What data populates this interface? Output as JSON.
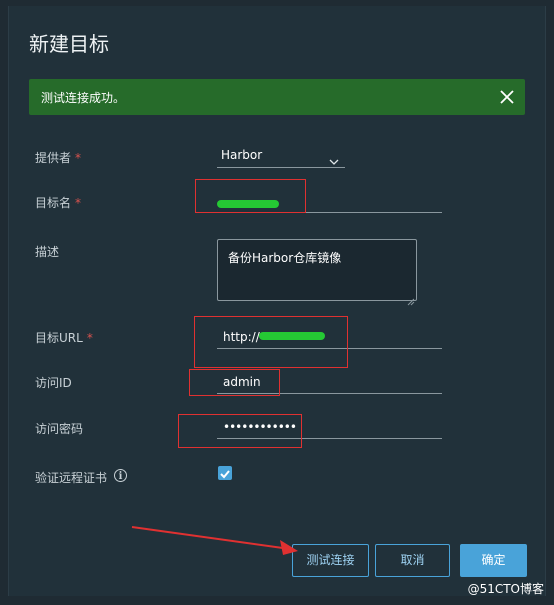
{
  "dialog": {
    "title": "新建目标"
  },
  "alert": {
    "message": "测试连接成功。",
    "close_icon": "close-icon"
  },
  "form": {
    "provider": {
      "label": "提供者",
      "required": "*",
      "value": "Harbor"
    },
    "target_name": {
      "label": "目标名",
      "required": "*",
      "value": ""
    },
    "description": {
      "label": "描述",
      "value": "备份Harbor仓库镜像"
    },
    "target_url": {
      "label": "目标URL",
      "required": "*",
      "value": "http://"
    },
    "access_id": {
      "label": "访问ID",
      "value": "admin"
    },
    "access_secret": {
      "label": "访问密码",
      "value": "••••••••••••"
    },
    "verify_cert": {
      "label": "验证远程证书",
      "info_icon": "info-icon",
      "checked": true
    }
  },
  "buttons": {
    "test": "测试连接",
    "cancel": "取消",
    "ok": "确定"
  },
  "watermark": "@51CTO博客",
  "colors": {
    "background": "#21313a",
    "success": "#266b2a",
    "accent": "#49a3d9",
    "annotation": "#e03131"
  }
}
